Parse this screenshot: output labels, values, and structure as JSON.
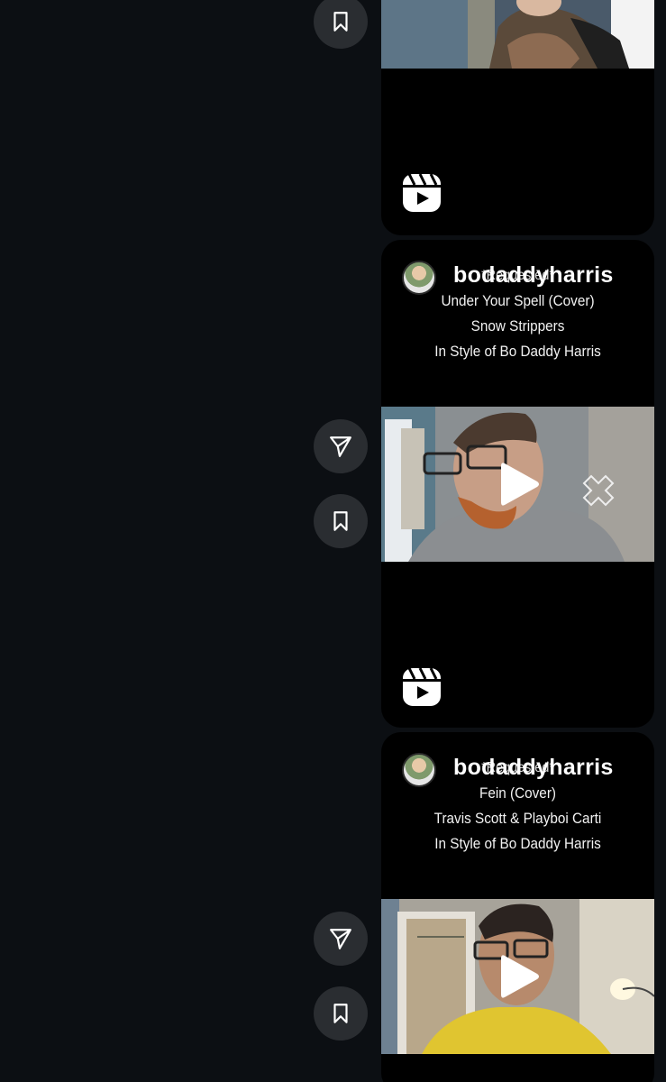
{
  "posts": [
    {
      "username": "",
      "caption": []
    },
    {
      "username": "bodaddyharris",
      "caption": [
        "*Requested*",
        "Under Your Spell (Cover)",
        "Snow Strippers",
        "In Style of Bo Daddy Harris"
      ]
    },
    {
      "username": "bodaddyharris",
      "caption": [
        "*Requested*",
        "Fein (Cover)",
        "Travis Scott & Playboi Carti",
        "In Style of Bo Daddy Harris"
      ]
    }
  ],
  "icons": {
    "share": "send-icon",
    "save": "bookmark-icon",
    "reel": "reels-icon",
    "play": "play-icon"
  },
  "colors": {
    "page_bg": "#0c0f13",
    "button_bg": "#2a2d31",
    "card_bg": "#000000"
  }
}
